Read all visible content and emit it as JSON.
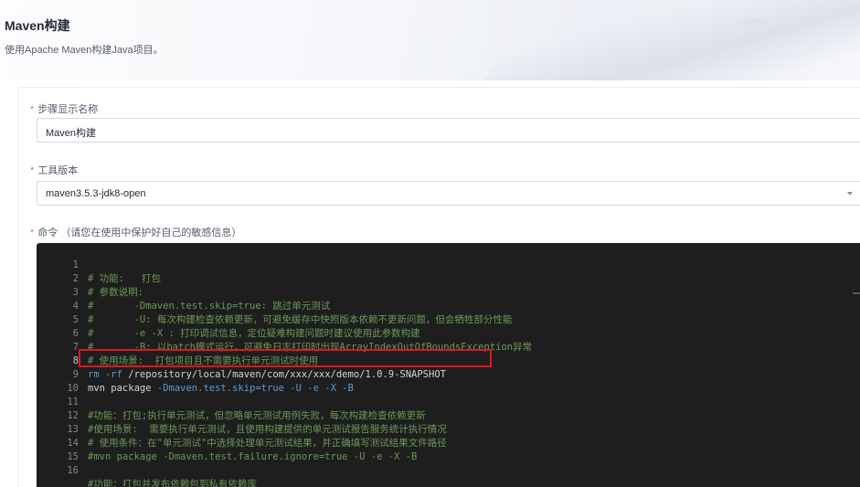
{
  "header": {
    "title": "Maven构建",
    "description": "使用Apache Maven构建Java项目。"
  },
  "form": {
    "step_name": {
      "required_mark": "*",
      "label": "步骤显示名称",
      "value": "Maven构建"
    },
    "tool_version": {
      "required_mark": "*",
      "label": "工具版本",
      "value": "maven3.5.3-jdk8-open",
      "icon": "chevron-down-icon"
    },
    "command": {
      "required_mark": "*",
      "label": "命令 （请您在使用中保护好自己的敏感信息）"
    }
  },
  "editor": {
    "lines": [
      {
        "num": "1",
        "text": "# 功能:   打包"
      },
      {
        "num": "2",
        "text": "# 参数说明:"
      },
      {
        "num": "3",
        "text": "#       -Dmaven.test.skip=true: 跳过单元测试"
      },
      {
        "num": "4",
        "text": "#       -U: 每次构建检查依赖更新，可避免缓存中快照版本依赖不更新问题，但会牺牲部分性能"
      },
      {
        "num": "5",
        "text": "#       -e -X : 打印调试信息，定位疑难构建问题时建议使用此参数构建"
      },
      {
        "num": "6",
        "text": "#       -B: 以batch模式运行，可避免日志打印时出现ArrayIndexOutOfBoundsException异常"
      },
      {
        "num": "7",
        "text": "# 使用场景:  打包项目且不需要执行单元测试时使用"
      },
      {
        "num": "8",
        "cmd": "rm",
        "flag": "-rf",
        "path": "/repository/local/maven/com/xxx/xxx/demo/1.0.9-SNAPSHOT"
      },
      {
        "num": "9",
        "cmd": "mvn package",
        "arg1": "-Dmaven.test.skip=true",
        "arg2": "-U",
        "arg3": "-e",
        "arg4": "-X",
        "arg5": "-B"
      },
      {
        "num": "10",
        "text": ""
      },
      {
        "num": "11",
        "text": "#功能：打包;执行单元测试，但忽略单元测试用例失败，每次构建检查依赖更新"
      },
      {
        "num": "12",
        "text": "#使用场景:  需要执行单元测试，且使用构建提供的单元测试报告服务统计执行情况"
      },
      {
        "num": "13",
        "text": "# 使用条件：在\"单元测试\"中选择处理单元测试结果，并正确填写测试结果文件路径"
      },
      {
        "num": "14",
        "text": "#mvn package -Dmaven.test.failure.ignore=true -U -e -X -B"
      },
      {
        "num": "15",
        "text": ""
      },
      {
        "num": "16",
        "text": "#功能：打包并发布依赖包到私有依赖库"
      }
    ],
    "colors": {
      "background": "#1e1e1e",
      "comment": "#6a9955",
      "keyword": "#569cd6",
      "highlight_border": "#e5131b"
    }
  }
}
